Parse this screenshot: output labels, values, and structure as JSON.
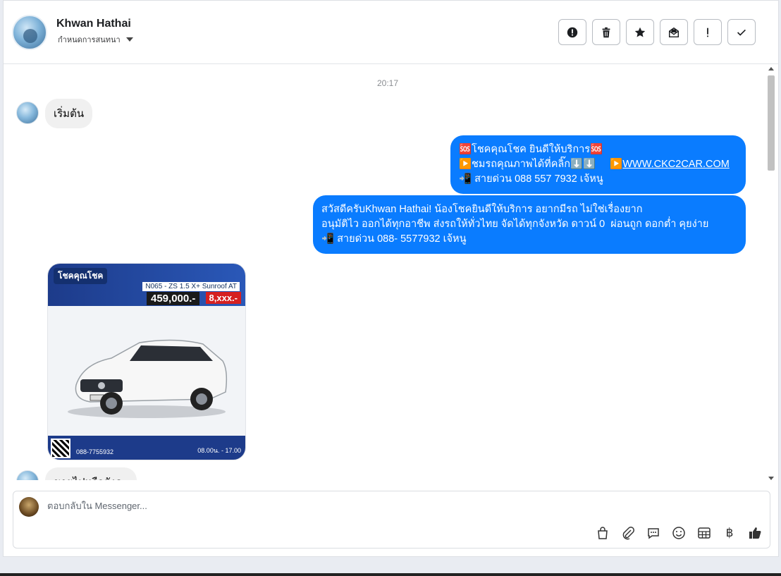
{
  "header": {
    "contact_name": "Khwan Hathai",
    "subtitle": "กำหนดการสนทนา",
    "actions": [
      {
        "name": "spam-button",
        "icon": "alert-circle-icon"
      },
      {
        "name": "delete-button",
        "icon": "trash-icon"
      },
      {
        "name": "star-button",
        "icon": "star-icon"
      },
      {
        "name": "mark-unread-button",
        "icon": "mail-open-icon"
      },
      {
        "name": "important-button",
        "icon": "exclamation-icon"
      },
      {
        "name": "done-button",
        "icon": "check-icon"
      }
    ]
  },
  "chat": {
    "timestamp": "20:17",
    "msg_start": "เริ่มต้น",
    "msg_out_1_line1": "🆘โชคคุณโชค ยินดีให้บริการ🆘",
    "msg_out_1_line2": "▶️ชมรถคุณภาพได้ที่คลิ๊ก⬇️⬇️     ▶️",
    "msg_out_1_link": "WWW.CKC2CAR.COM",
    "msg_out_1_line3": "📲 สายด่วน 088 557 7932 เจ้หนู",
    "msg_out_2": "สวัสดีครับKhwan Hathai! น้องโชคยินดีให้บริการ อยากมีรถ ไม่ใช่เรื่องยาก\nอนุมัติไว ออกได้ทุกอาชีพ ส่งรถให้ทั่วไทย จัดได้ทุกจังหวัด ดาวน์ 0  ผ่อนถูก ดอกต่ำ คุยง่าย\n📲 สายด่วน 088- 5577932 เจ้หนู",
    "car_card": {
      "logo": "โชคคุณโชค",
      "model": "N065 - ZS 1.5 X+ Sunroof AT",
      "price": "459,000.-",
      "monthly": "8,xxx.-",
      "phone": "088-7755932",
      "hours": "08.00น. - 17.00"
    },
    "msg_partial": "ขายไปหรือยังคะ"
  },
  "composer": {
    "placeholder": "ตอบกลับใน Messenger...",
    "baht_symbol": "฿"
  }
}
